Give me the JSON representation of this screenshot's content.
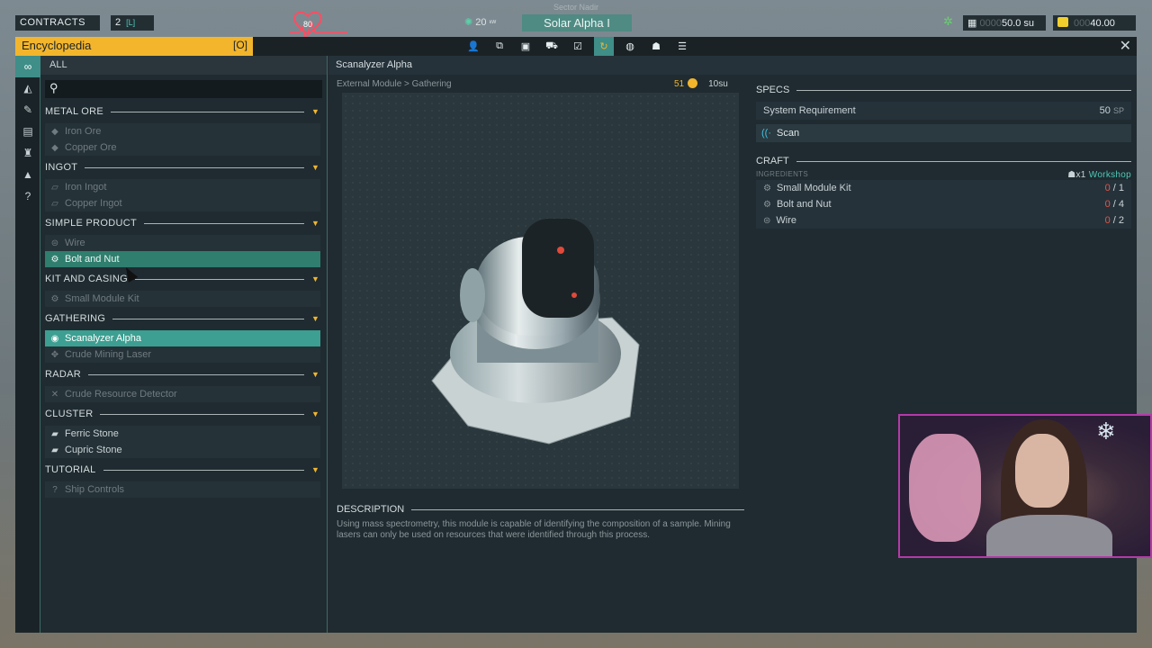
{
  "hud": {
    "contracts_label": "CONTRACTS",
    "contracts_count": "2",
    "contracts_key": "[L]",
    "heart_value": "80",
    "sector": "Sector Nadir",
    "power": "20",
    "power_unit": "ᵏᵂ",
    "ship_name": "Solar Alpha I",
    "su_dim": "0000",
    "su_value": "50.0 su",
    "fuel_dim": "000",
    "fuel_value": "40.00",
    "icons": {
      "bug": "bug-icon",
      "grid": "grid-icon",
      "fuel": "fuel-icon"
    }
  },
  "window": {
    "title": "Encyclopedia",
    "title_key": "[O]",
    "close": "✕",
    "tabs": [
      {
        "icon": "person-icon",
        "glyph": "👤",
        "active": false
      },
      {
        "icon": "network-icon",
        "glyph": "⧉",
        "active": false
      },
      {
        "icon": "map-icon",
        "glyph": "▣",
        "active": false
      },
      {
        "icon": "rocket-icon",
        "glyph": "⛟",
        "active": false
      },
      {
        "icon": "checklist-icon",
        "glyph": "☑",
        "active": false
      },
      {
        "icon": "encyclopedia-icon",
        "glyph": "↻",
        "active": true
      },
      {
        "icon": "globe-icon",
        "glyph": "◍",
        "active": false
      },
      {
        "icon": "crew-icon",
        "glyph": "☗",
        "active": false
      },
      {
        "icon": "log-icon",
        "glyph": "☰",
        "active": false
      }
    ]
  },
  "strip": [
    {
      "icon": "infinity-icon",
      "glyph": "∞",
      "active": true
    },
    {
      "icon": "drill-icon",
      "glyph": "◭",
      "active": false
    },
    {
      "icon": "tool-icon",
      "glyph": "✎",
      "active": false
    },
    {
      "icon": "printer-icon",
      "glyph": "▤",
      "active": false
    },
    {
      "icon": "trophy-icon",
      "glyph": "♜",
      "active": false
    },
    {
      "icon": "triangle-icon",
      "glyph": "▲",
      "active": false
    },
    {
      "icon": "help-icon",
      "glyph": "?",
      "active": false
    }
  ],
  "list": {
    "all_label": "ALL",
    "search_placeholder": "",
    "categories": [
      {
        "name": "METAL ORE",
        "items": [
          {
            "label": "Iron Ore",
            "glyph": "◆",
            "state": ""
          },
          {
            "label": "Copper Ore",
            "glyph": "◆",
            "state": ""
          }
        ]
      },
      {
        "name": "INGOT",
        "items": [
          {
            "label": "Iron Ingot",
            "glyph": "▱",
            "state": ""
          },
          {
            "label": "Copper Ingot",
            "glyph": "▱",
            "state": ""
          }
        ]
      },
      {
        "name": "SIMPLE PRODUCT",
        "items": [
          {
            "label": "Wire",
            "glyph": "⊜",
            "state": ""
          },
          {
            "label": "Bolt and Nut",
            "glyph": "⚙",
            "state": "hover"
          }
        ]
      },
      {
        "name": "KIT AND CASING",
        "items": [
          {
            "label": "Small Module Kit",
            "glyph": "⚙",
            "state": ""
          }
        ]
      },
      {
        "name": "GATHERING",
        "items": [
          {
            "label": "Scanalyzer Alpha",
            "glyph": "◉",
            "state": "selected"
          },
          {
            "label": "Crude Mining Laser",
            "glyph": "✥",
            "state": ""
          }
        ]
      },
      {
        "name": "RADAR",
        "items": [
          {
            "label": "Crude Resource Detector",
            "glyph": "✕",
            "state": ""
          }
        ]
      },
      {
        "name": "CLUSTER",
        "items": [
          {
            "label": "Ferric Stone",
            "glyph": "▰",
            "state": "bright"
          },
          {
            "label": "Cupric Stone",
            "glyph": "▰",
            "state": "bright"
          }
        ]
      },
      {
        "name": "TUTORIAL",
        "items": [
          {
            "label": "Ship Controls",
            "glyph": "?",
            "state": ""
          }
        ]
      }
    ]
  },
  "detail": {
    "title": "Scanalyzer Alpha",
    "breadcrumb": "External Module > Gathering",
    "stock_count": "51",
    "price": "10su",
    "description_title": "DESCRIPTION",
    "description": "Using mass spectrometry, this module is capable of identifying the composition of a sample. Mining lasers can only be used on resources that were identified through this process."
  },
  "specs": {
    "title": "SPECS",
    "system_requirement_label": "System Requirement",
    "system_requirement_value": "50",
    "system_requirement_unit": "SP",
    "ability": "Scan"
  },
  "craft": {
    "title": "CRAFT",
    "ingredients_label": "INGREDIENTS",
    "workshop_count": "x1",
    "workshop_label": "Workshop",
    "ingredients": [
      {
        "name": "Small Module Kit",
        "have": "0",
        "need": "/ 1",
        "glyph": "⚙"
      },
      {
        "name": "Bolt and Nut",
        "have": "0",
        "need": "/ 4",
        "glyph": "⚙"
      },
      {
        "name": "Wire",
        "have": "0",
        "need": "/ 2",
        "glyph": "⊜"
      }
    ]
  },
  "colors": {
    "accent": "#f2b52c",
    "teal": "#3c9f91",
    "panel": "#1f2b30"
  }
}
